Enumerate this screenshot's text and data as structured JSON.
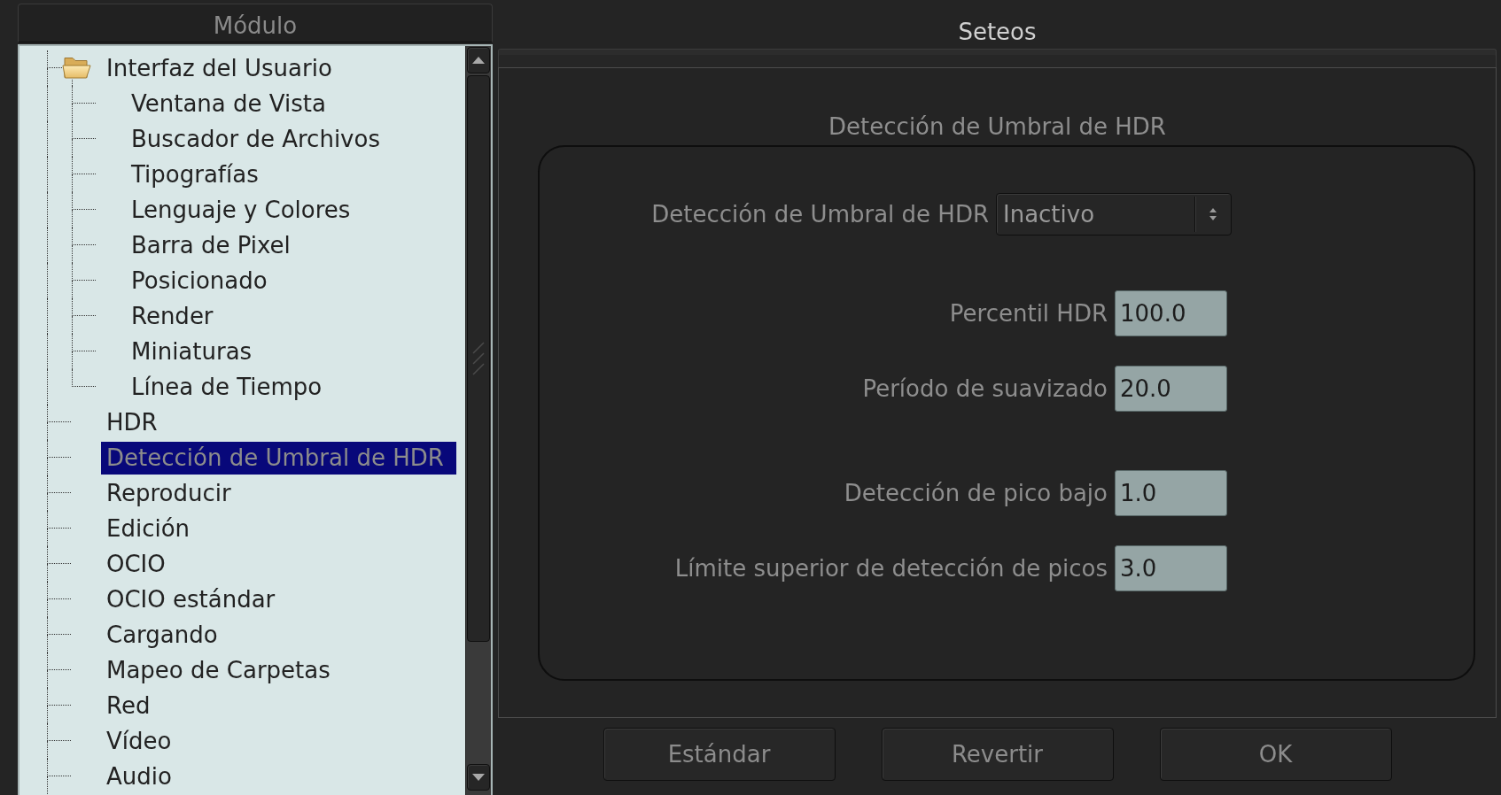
{
  "module_panel": {
    "header": "Módulo",
    "tree": [
      {
        "label": "Interfaz del Usuario",
        "selected": false,
        "expanded": true,
        "children": [
          {
            "label": "Ventana de Vista",
            "selected": false
          },
          {
            "label": "Buscador de Archivos",
            "selected": false
          },
          {
            "label": "Tipografías",
            "selected": false
          },
          {
            "label": "Lenguaje y Colores",
            "selected": false
          },
          {
            "label": "Barra de Pixel",
            "selected": false
          },
          {
            "label": "Posicionado",
            "selected": false
          },
          {
            "label": "Render",
            "selected": false
          },
          {
            "label": "Miniaturas",
            "selected": false
          },
          {
            "label": "Línea de Tiempo",
            "selected": false
          }
        ]
      },
      {
        "label": "HDR",
        "selected": false
      },
      {
        "label": "Detección de Umbral de HDR",
        "selected": true
      },
      {
        "label": "Reproducir",
        "selected": false
      },
      {
        "label": "Edición",
        "selected": false
      },
      {
        "label": "OCIO",
        "selected": false
      },
      {
        "label": "OCIO estándar",
        "selected": false
      },
      {
        "label": "Cargando",
        "selected": false
      },
      {
        "label": "Mapeo de Carpetas",
        "selected": false
      },
      {
        "label": "Red",
        "selected": false
      },
      {
        "label": "Vídeo",
        "selected": false
      },
      {
        "label": "Audio",
        "selected": false
      }
    ]
  },
  "settings_panel": {
    "title": "Seteos",
    "group": {
      "title": "Detección de Umbral de HDR",
      "sections": [
        {
          "fields": [
            {
              "kind": "combo",
              "label": "Detección de Umbral de HDR",
              "value": "Inactivo"
            }
          ]
        },
        {
          "fields": [
            {
              "kind": "number",
              "label": "Percentil HDR",
              "value": "100.0"
            },
            {
              "kind": "number",
              "label": "Período de suavizado",
              "value": "20.0"
            }
          ]
        },
        {
          "fields": [
            {
              "kind": "number",
              "label": "Detección de pico bajo",
              "value": "1.0"
            },
            {
              "kind": "number",
              "label": "Límite superior de detección de picos",
              "value": "3.0"
            }
          ]
        }
      ]
    }
  },
  "buttons": [
    "Estándar",
    "Revertir",
    "OK"
  ]
}
